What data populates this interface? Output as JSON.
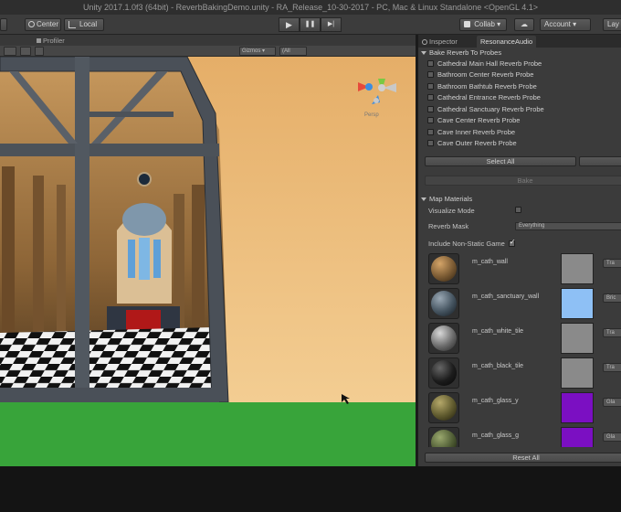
{
  "window": {
    "title": "Unity 2017.1.0f3 (64bit) - ReverbBakingDemo.unity - RA_Release_10-30-2017 - PC, Mac & Linux Standalone <OpenGL 4.1>"
  },
  "toolbar": {
    "center_label": "Center",
    "local_label": "Local",
    "play_icon": "▶",
    "pause_icon": "❚❚",
    "step_icon": "▶|",
    "collab_label": "Collab ▾",
    "cloud_icon": "☁",
    "account_label": "Account ▾",
    "layers_label": "Lay"
  },
  "scene_tabs": {
    "profiler_label": "Profiler"
  },
  "scene_toolbar": {
    "gizmos_label": "Gizmos ▾",
    "search_label": "(All"
  },
  "gizmo": {
    "persp_label": "Persp",
    "x_label": "x",
    "y_label": "y"
  },
  "inspector": {
    "tabs": [
      "Inspector",
      "ResonanceAudio"
    ],
    "bake_section_title": "Bake Reverb To Probes",
    "probes": [
      "Cathedral Main Hall Reverb Probe",
      "Bathroom Center Reverb Probe",
      "Bathroom Bathtub Reverb Probe",
      "Cathedral Entrance Reverb Probe",
      "Cathedral Sanctuary Reverb Probe",
      "Cave Center Reverb Probe",
      "Cave Inner Reverb Probe",
      "Cave Outer Reverb Probe"
    ],
    "select_all_label": "Select All",
    "bake_label": "Bake",
    "map_section_title": "Map Materials",
    "visualize_mode_label": "Visualize Mode",
    "reverb_mask_label": "Reverb Mask",
    "reverb_mask_value": "Everything",
    "include_non_static_label": "Include Non-Static Game",
    "materials": [
      {
        "name": "m_cath_wall",
        "swatch": "#8a8a8a",
        "button": "Tra",
        "sphere": "#7a5a33"
      },
      {
        "name": "m_cath_sanctuary_wall",
        "swatch": "#8ec0f5",
        "button": "Bric",
        "sphere": "#44535f"
      },
      {
        "name": "m_cath_white_tile",
        "swatch": "#8a8a8a",
        "button": "Tra",
        "sphere": "#6a6a6a"
      },
      {
        "name": "m_cath_black_tile",
        "swatch": "#8a8a8a",
        "button": "Tra",
        "sphere": "#1c1c1c"
      },
      {
        "name": "m_cath_glass_y",
        "swatch": "#7b0fc2",
        "button": "Gla",
        "sphere": "#5f5a2e"
      },
      {
        "name": "m_cath_glass_g",
        "swatch": "#7b0fc2",
        "button": "Gla",
        "sphere": "#4d5a33"
      }
    ],
    "reset_all_label": "Reset All"
  }
}
